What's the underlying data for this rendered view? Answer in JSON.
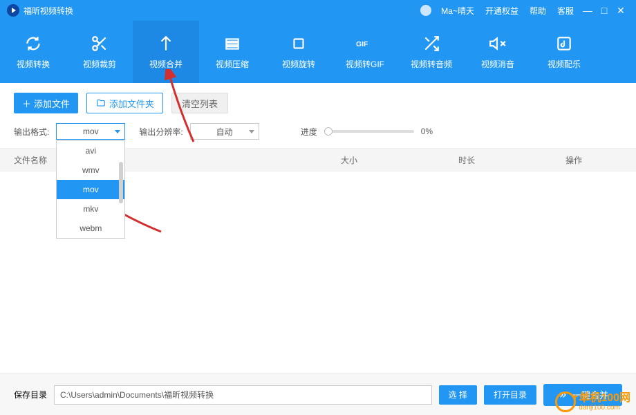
{
  "titlebar": {
    "app_name": "福昕视频转换",
    "username": "Ma~晴天",
    "links": [
      "开通权益",
      "帮助",
      "客服"
    ]
  },
  "tabs": [
    {
      "label": "视频转换",
      "icon": "refresh-icon"
    },
    {
      "label": "视频裁剪",
      "icon": "scissors-icon"
    },
    {
      "label": "视频合并",
      "icon": "merge-icon",
      "active": true
    },
    {
      "label": "视频压缩",
      "icon": "compress-icon"
    },
    {
      "label": "视频旋转",
      "icon": "rotate-icon"
    },
    {
      "label": "视频转GIF",
      "icon": "gif-icon"
    },
    {
      "label": "视频转音频",
      "icon": "shuffle-icon"
    },
    {
      "label": "视频消音",
      "icon": "mute-icon"
    },
    {
      "label": "视频配乐",
      "icon": "music-icon"
    }
  ],
  "actions": {
    "add_file": "添加文件",
    "add_folder": "添加文件夹",
    "clear_list": "清空列表"
  },
  "params": {
    "format_label": "输出格式:",
    "format_value": "mov",
    "format_options": [
      "avi",
      "wmv",
      "mov",
      "mkv",
      "webm"
    ],
    "res_label": "输出分辨率:",
    "res_value": "自动",
    "progress_label": "进度",
    "progress_pct": "0%"
  },
  "table": {
    "col_name": "文件名称",
    "col_size": "大小",
    "col_dur": "时长",
    "col_op": "操作"
  },
  "footer": {
    "save_label": "保存目录",
    "path": "C:\\Users\\admin\\Documents\\福昕视频转换",
    "choose": "选 择",
    "open": "打开目录",
    "merge": "一键合并"
  },
  "watermark": {
    "line1": "单机100网",
    "line2": "danji100.com"
  }
}
